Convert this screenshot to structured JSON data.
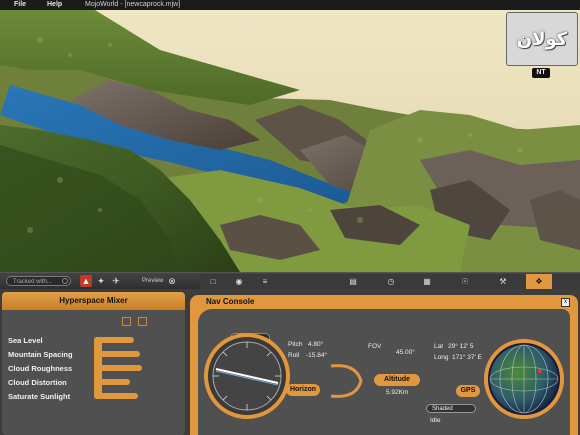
{
  "menu": {
    "file": "File",
    "help": "Help",
    "title": "MojoWorld - [newcaprock.mjw]"
  },
  "logo": {
    "text": "كولان",
    "sub": "NT"
  },
  "toolbar": {
    "search_placeholder": "Tracked with...",
    "preview_label": "Preview"
  },
  "mixer": {
    "title": "Hyperspace Mixer",
    "items": [
      {
        "label": "Sea Level"
      },
      {
        "label": "Mountain Spacing"
      },
      {
        "label": "Cloud Roughness"
      },
      {
        "label": "Cloud Distortion"
      },
      {
        "label": "Saturate Sunlight"
      }
    ]
  },
  "nav": {
    "title": "Nav Console",
    "close": "x",
    "stepper": "◄ · S",
    "pitch_label": "Pitch",
    "pitch_value": "4.80°",
    "roll_label": "Roll",
    "roll_value": "-15.84°",
    "fov_label": "FOV",
    "fov_value": "45.00°",
    "lat_label": "Lat",
    "lat_value": "29° 12' 5",
    "long_label": "Long",
    "long_value": "171° 37' E",
    "horizon_label": "Horizon",
    "altitude_label": "Altitude",
    "altitude_value": "5.92Km",
    "gps_label": "GPS",
    "shaded": "Shaded",
    "idle": "Idle"
  }
}
